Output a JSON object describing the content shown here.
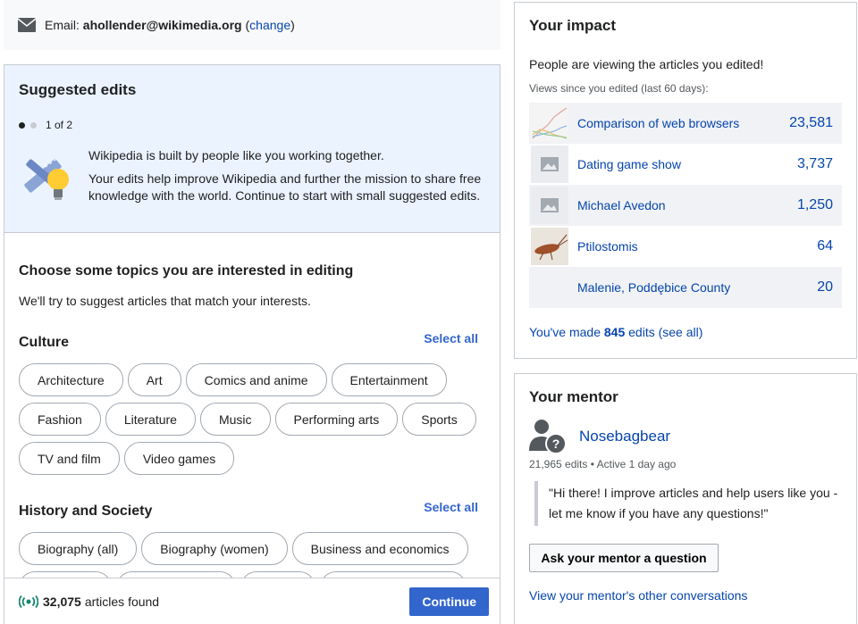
{
  "email_bar": {
    "prefix": "Email:",
    "address": "ahollender@wikimedia.org",
    "open_paren": "(",
    "change_label": "change",
    "close_paren": ")"
  },
  "suggested_edits": {
    "title": "Suggested edits",
    "pager": "1 of 2",
    "intro_line1": "Wikipedia is built by people like you working together.",
    "intro_line2": "Your edits help improve Wikipedia and further the mission to share free knowledge with the world. Continue to start with small suggested edits."
  },
  "topics": {
    "title": "Choose some topics you are interested in editing",
    "subtitle": "We'll try to suggest articles that match your interests.",
    "select_all": "Select all",
    "groups": [
      {
        "name": "Culture",
        "chips": [
          "Architecture",
          "Art",
          "Comics and anime",
          "Entertainment",
          "Fashion",
          "Literature",
          "Music",
          "Performing arts",
          "Sports",
          "TV and film",
          "Video games"
        ]
      },
      {
        "name": "History and Society",
        "chips": [
          "Biography (all)",
          "Biography (women)",
          "Business and economics"
        ]
      }
    ]
  },
  "footer": {
    "count": "32,075",
    "count_label": "articles found",
    "continue_label": "Continue"
  },
  "impact": {
    "title": "Your impact",
    "subtitle": "People are viewing the articles you edited!",
    "views_label": "Views since you edited (last 60 days):",
    "articles": [
      {
        "title": "Comparison of web browsers",
        "views": "23,581"
      },
      {
        "title": "Dating game show",
        "views": "3,737"
      },
      {
        "title": "Michael Avedon",
        "views": "1,250"
      },
      {
        "title": "Ptilostomis",
        "views": "64"
      },
      {
        "title": "Malenie, Poddębice County",
        "views": "20"
      }
    ],
    "edits_prefix": "You've made",
    "edits_count": "845",
    "edits_suffix": "edits (see all)"
  },
  "mentor": {
    "title": "Your mentor",
    "name": "Nosebagbear",
    "edits": "21,965 edits",
    "separator": "•",
    "active": "Active 1 day ago",
    "quote": "\"Hi there! I improve articles and help users like you - let me know if you have any questions!\"",
    "ask_label": "Ask your mentor a question",
    "other_label": "View your mentor's other conversations"
  },
  "colors": {
    "link": "#0645ad",
    "accent": "#3366cc",
    "panel_bg": "#eaf3ff",
    "success": "#14866d"
  }
}
